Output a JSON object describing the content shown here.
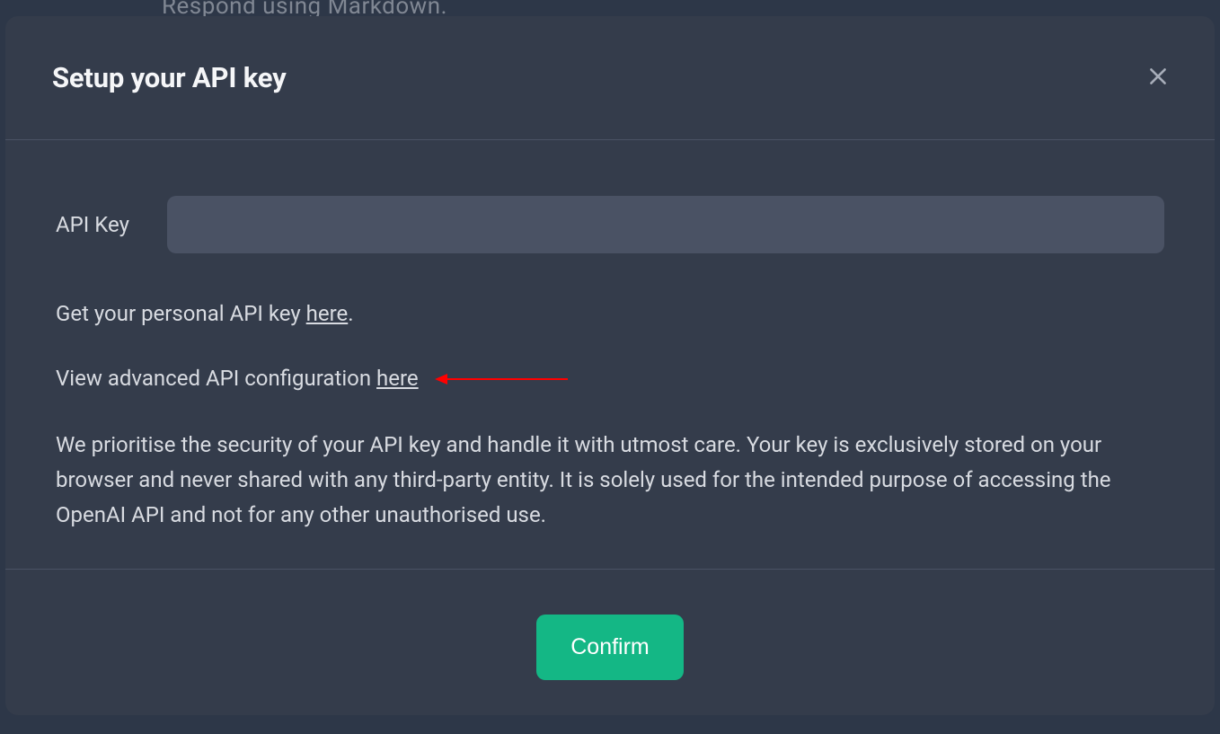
{
  "background": {
    "hint_text": "Respond using Markdown."
  },
  "modal": {
    "title": "Setup your API key",
    "form": {
      "api_key_label": "API Key",
      "api_key_value": ""
    },
    "help": {
      "get_key_prefix": "Get your personal API key ",
      "get_key_link": "here",
      "get_key_suffix": ".",
      "advanced_prefix": "View advanced API configuration ",
      "advanced_link": "here"
    },
    "security_text": "We prioritise the security of your API key and handle it with utmost care. Your key is exclusively stored on your browser and never shared with any third-party entity. It is solely used for the intended purpose of accessing the OpenAI API and not for any other unauthorised use.",
    "confirm_label": "Confirm"
  },
  "colors": {
    "modal_bg": "#343c4b",
    "input_bg": "#4a5264",
    "accent": "#14b785",
    "text": "#d8dbe1",
    "annotation": "#ff0000"
  }
}
